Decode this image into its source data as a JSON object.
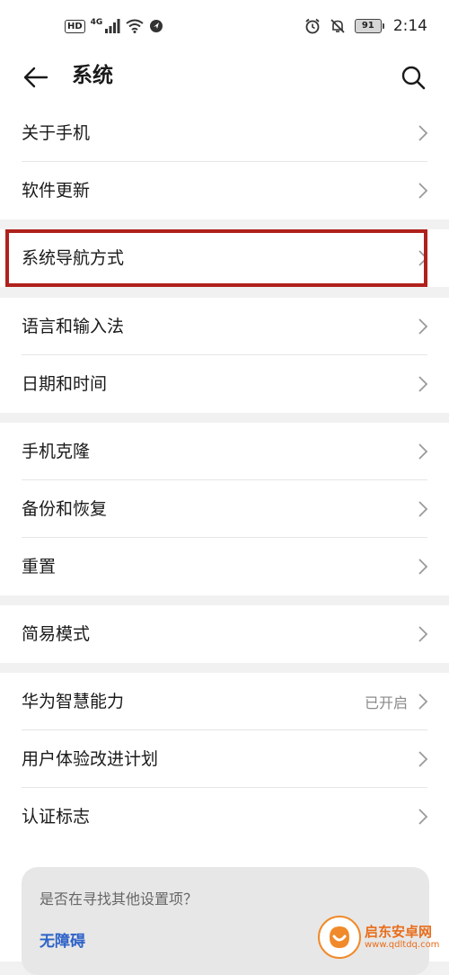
{
  "status_bar": {
    "hd": "HD",
    "network": "4G",
    "battery": "91",
    "time": "2:14"
  },
  "header": {
    "title": "系统"
  },
  "groups": [
    {
      "items": [
        {
          "label": "关于手机"
        },
        {
          "label": "软件更新"
        }
      ]
    },
    {
      "items": [
        {
          "label": "系统导航方式"
        }
      ]
    },
    {
      "items": [
        {
          "label": "语言和输入法"
        },
        {
          "label": "日期和时间"
        }
      ]
    },
    {
      "items": [
        {
          "label": "手机克隆"
        },
        {
          "label": "备份和恢复"
        },
        {
          "label": "重置"
        }
      ]
    },
    {
      "items": [
        {
          "label": "简易模式"
        }
      ]
    },
    {
      "items": [
        {
          "label": "华为智慧能力",
          "value": "已开启"
        },
        {
          "label": "用户体验改进计划"
        },
        {
          "label": "认证标志"
        }
      ]
    }
  ],
  "suggestion": {
    "title": "是否在寻找其他设置项？",
    "link": "无障碍"
  },
  "watermark": {
    "name": "启东安卓网",
    "url": "www.qdltdq.com"
  },
  "colors": {
    "highlight": "#b0211c",
    "link": "#2e63c8",
    "watermark": "#e86d1a"
  }
}
